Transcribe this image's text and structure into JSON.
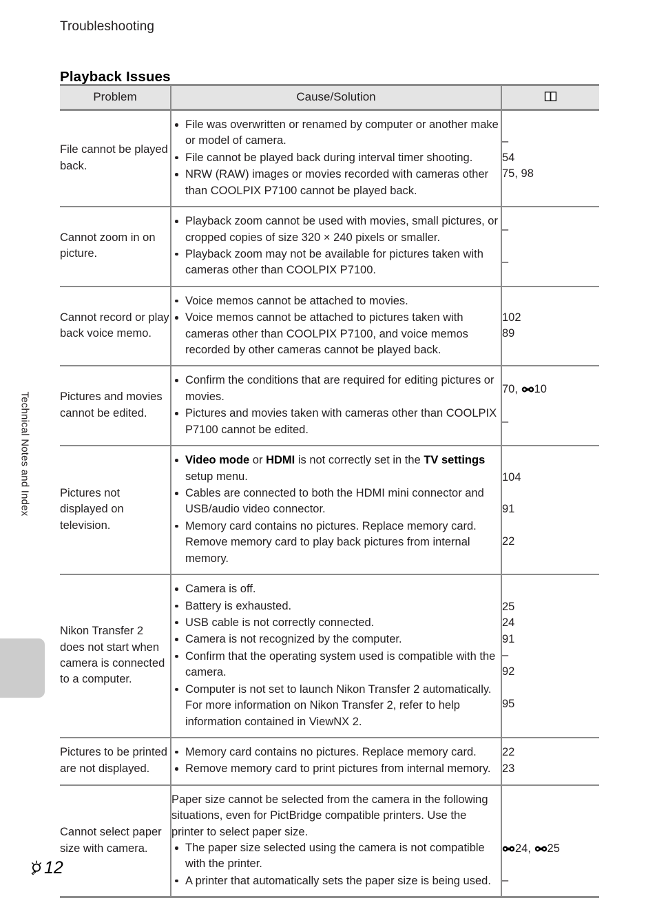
{
  "page": {
    "running_head": "Troubleshooting",
    "section_title": "Playback Issues",
    "side_tab_label": "Technical Notes and Index",
    "footer_icon": "lightbulb-icon",
    "footer_page": "12",
    "colors": {
      "header_background": "#e4e4e4",
      "rule": "#8b8b8b",
      "text": "#231f20",
      "side_tab": "#cccccc"
    }
  },
  "table": {
    "headers": {
      "problem": "Problem",
      "cause": "Cause/Solution",
      "reference_icon": "open-book-icon"
    },
    "rows": [
      {
        "problem": "File cannot be played back.",
        "lead": "",
        "bullets": [
          "File was overwritten or renamed by computer or another make or model of camera.",
          "File cannot be played back during interval timer shooting.",
          "NRW (RAW) images or movies recorded with cameras other than COOLPIX P7100 cannot be played back."
        ],
        "refs": [
          "–",
          "54",
          "75, 98"
        ]
      },
      {
        "problem": "Cannot zoom in on picture.",
        "lead": "",
        "bullets": [
          "Playback zoom cannot be used with movies, small pictures, or cropped copies of size 320 × 240 pixels or smaller.",
          "Playback zoom may not be available for pictures taken with cameras other than COOLPIX P7100."
        ],
        "refs": [
          "–",
          "",
          "–"
        ]
      },
      {
        "problem": "Cannot record or play back voice memo.",
        "lead": "",
        "bullets": [
          "Voice memos cannot be attached to movies.",
          "Voice memos cannot be attached to pictures taken with cameras other than COOLPIX P7100, and voice memos recorded by other cameras cannot be played back."
        ],
        "refs": [
          "102",
          "89"
        ]
      },
      {
        "problem": "Pictures and movies cannot be edited.",
        "lead": "",
        "bullets": [
          "Confirm the conditions that are required for editing pictures or movies.",
          "Pictures and movies taken with cameras other than COOLPIX P7100 cannot be edited."
        ],
        "refs": [
          "70, ❦E10",
          "",
          "–"
        ]
      },
      {
        "problem": "Pictures not displayed on television.",
        "lead": "",
        "bullets": [
          "<b>Video mode</b> or <b>HDMI</b> is not correctly set in the <b>TV settings</b> setup menu.",
          "Cables are connected to both the HDMI mini connector and USB/audio video connector.",
          "Memory card contains no pictures. Replace memory card. Remove memory card to play back pictures from internal memory."
        ],
        "refs": [
          "104",
          "",
          "91",
          "",
          "22"
        ]
      },
      {
        "problem": "Nikon Transfer 2 does not start when camera is connected to a computer.",
        "lead": "",
        "bullets": [
          "Camera is off.",
          "Battery is exhausted.",
          "USB cable is not correctly connected.",
          "Camera is not recognized by the computer.",
          "Confirm that the operating system used is compatible with the camera.",
          "Computer is not set to launch Nikon Transfer 2 automatically. For more information on Nikon Transfer 2, refer to help information contained in ViewNX 2."
        ],
        "refs": [
          "25",
          "24",
          "91",
          "–",
          "92",
          "",
          "95"
        ]
      },
      {
        "problem": "Pictures to be printed are not displayed.",
        "lead": "",
        "bullets": [
          "Memory card contains no pictures. Replace memory card.",
          "Remove memory card to print pictures from internal memory."
        ],
        "refs": [
          "22",
          "23"
        ]
      },
      {
        "problem": "Cannot select paper size with camera.",
        "lead": "Paper size cannot be selected from the camera in the following situations, even for PictBridge compatible printers. Use the printer to select paper size.",
        "bullets": [
          "The paper size selected using the camera is not compatible with the printer.",
          "A printer that automatically sets the paper size is being used."
        ],
        "refs": [
          "",
          "",
          "",
          "❦E24, ❦E25",
          "",
          "–"
        ]
      }
    ]
  }
}
